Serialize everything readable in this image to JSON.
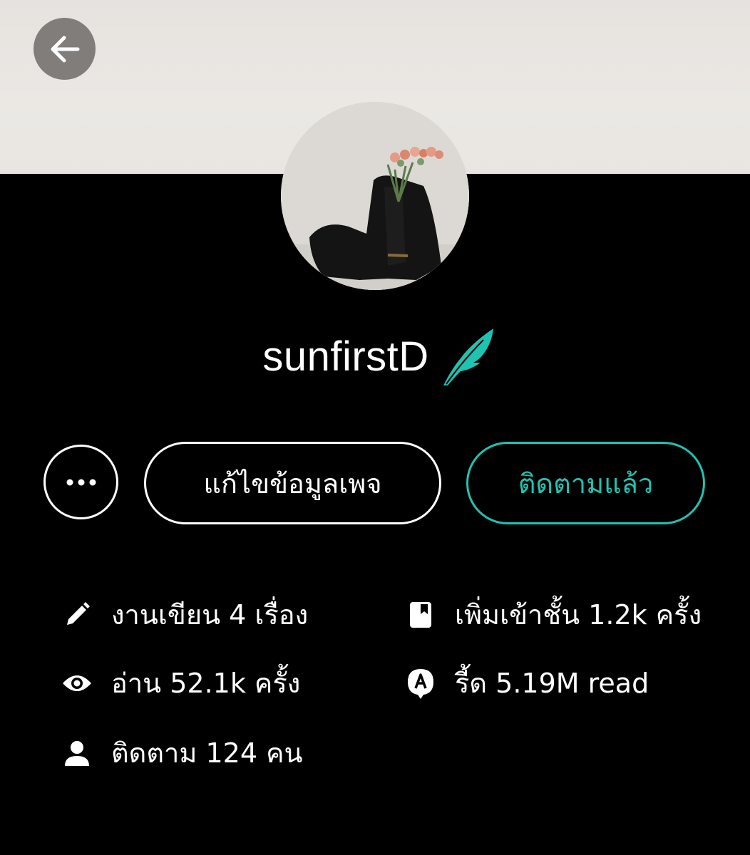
{
  "profile": {
    "username": "sunfirstD"
  },
  "actions": {
    "edit_label": "แก้ไขข้อมูลเพจ",
    "follow_label": "ติดตามแล้ว"
  },
  "stats": {
    "works": "งานเขียน 4 เรื่อง",
    "reads": "อ่าน 52.1k ครั้ง",
    "followers": "ติดตาม 124 คน",
    "shelf_adds": "เพิ่มเข้าชั้น 1.2k ครั้ง",
    "read_count": "รี้ด 5.19M read"
  },
  "colors": {
    "accent": "#1fc3b1",
    "background": "#000000",
    "text": "#ffffff"
  },
  "icons": {
    "back": "arrow-left-icon",
    "more": "more-dots-icon",
    "writer_badge": "quill-icon",
    "works": "pencil-icon",
    "reads": "eye-icon",
    "followers": "person-icon",
    "shelf_adds": "book-icon",
    "read_count": "read-badge-icon"
  }
}
